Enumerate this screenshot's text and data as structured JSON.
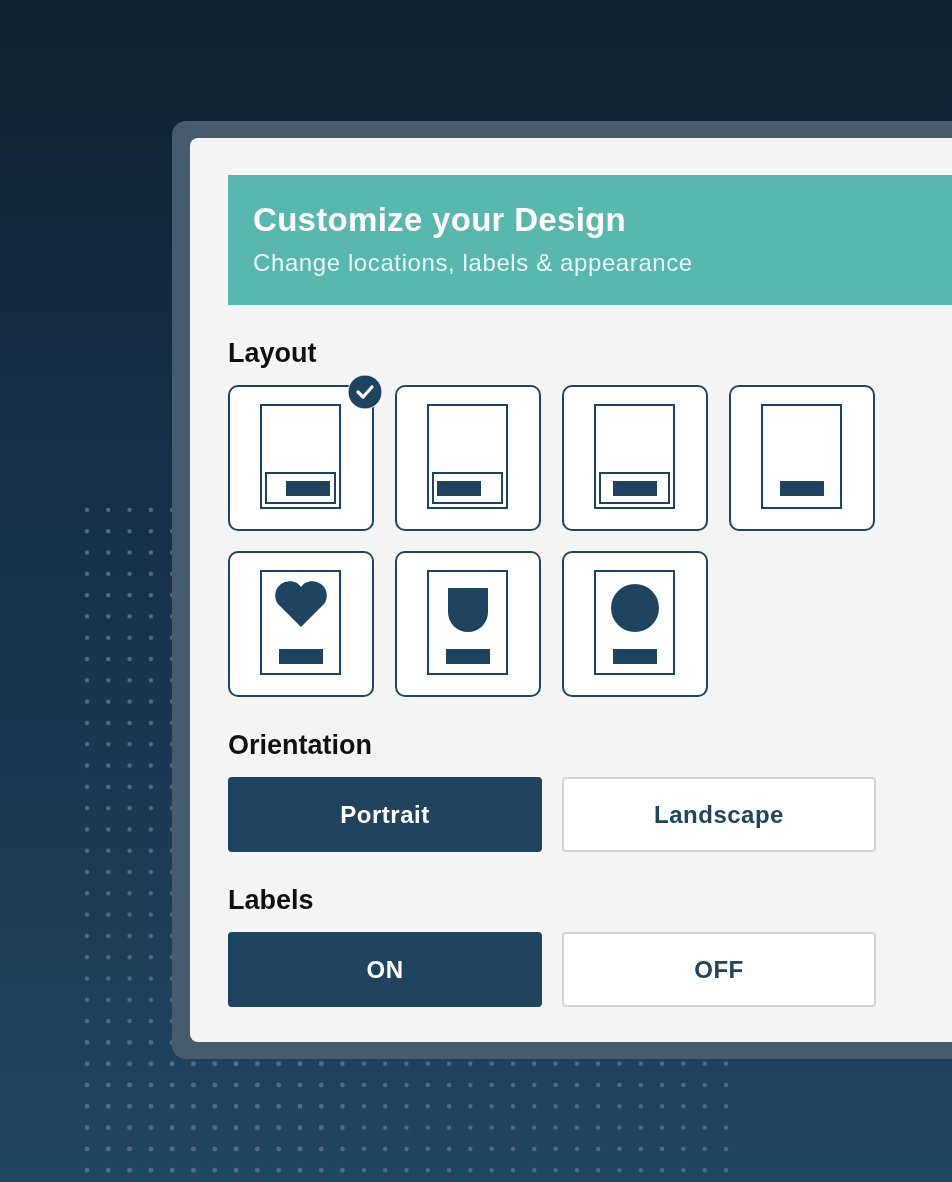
{
  "header": {
    "title": "Customize your Design",
    "subtitle": "Change locations, labels & appearance"
  },
  "layout": {
    "label": "Layout",
    "options": [
      {
        "kind": "panel-right",
        "selected": true
      },
      {
        "kind": "panel-left",
        "selected": false
      },
      {
        "kind": "panel-center",
        "selected": false
      },
      {
        "kind": "bar",
        "selected": false
      },
      {
        "kind": "heart",
        "selected": false
      },
      {
        "kind": "shield",
        "selected": false
      },
      {
        "kind": "circle",
        "selected": false
      }
    ]
  },
  "orientation": {
    "label": "Orientation",
    "options": [
      {
        "label": "Portrait",
        "selected": true
      },
      {
        "label": "Landscape",
        "selected": false
      }
    ]
  },
  "labels": {
    "label": "Labels",
    "options": [
      {
        "label": "ON",
        "selected": true
      },
      {
        "label": "OFF",
        "selected": false
      }
    ]
  }
}
